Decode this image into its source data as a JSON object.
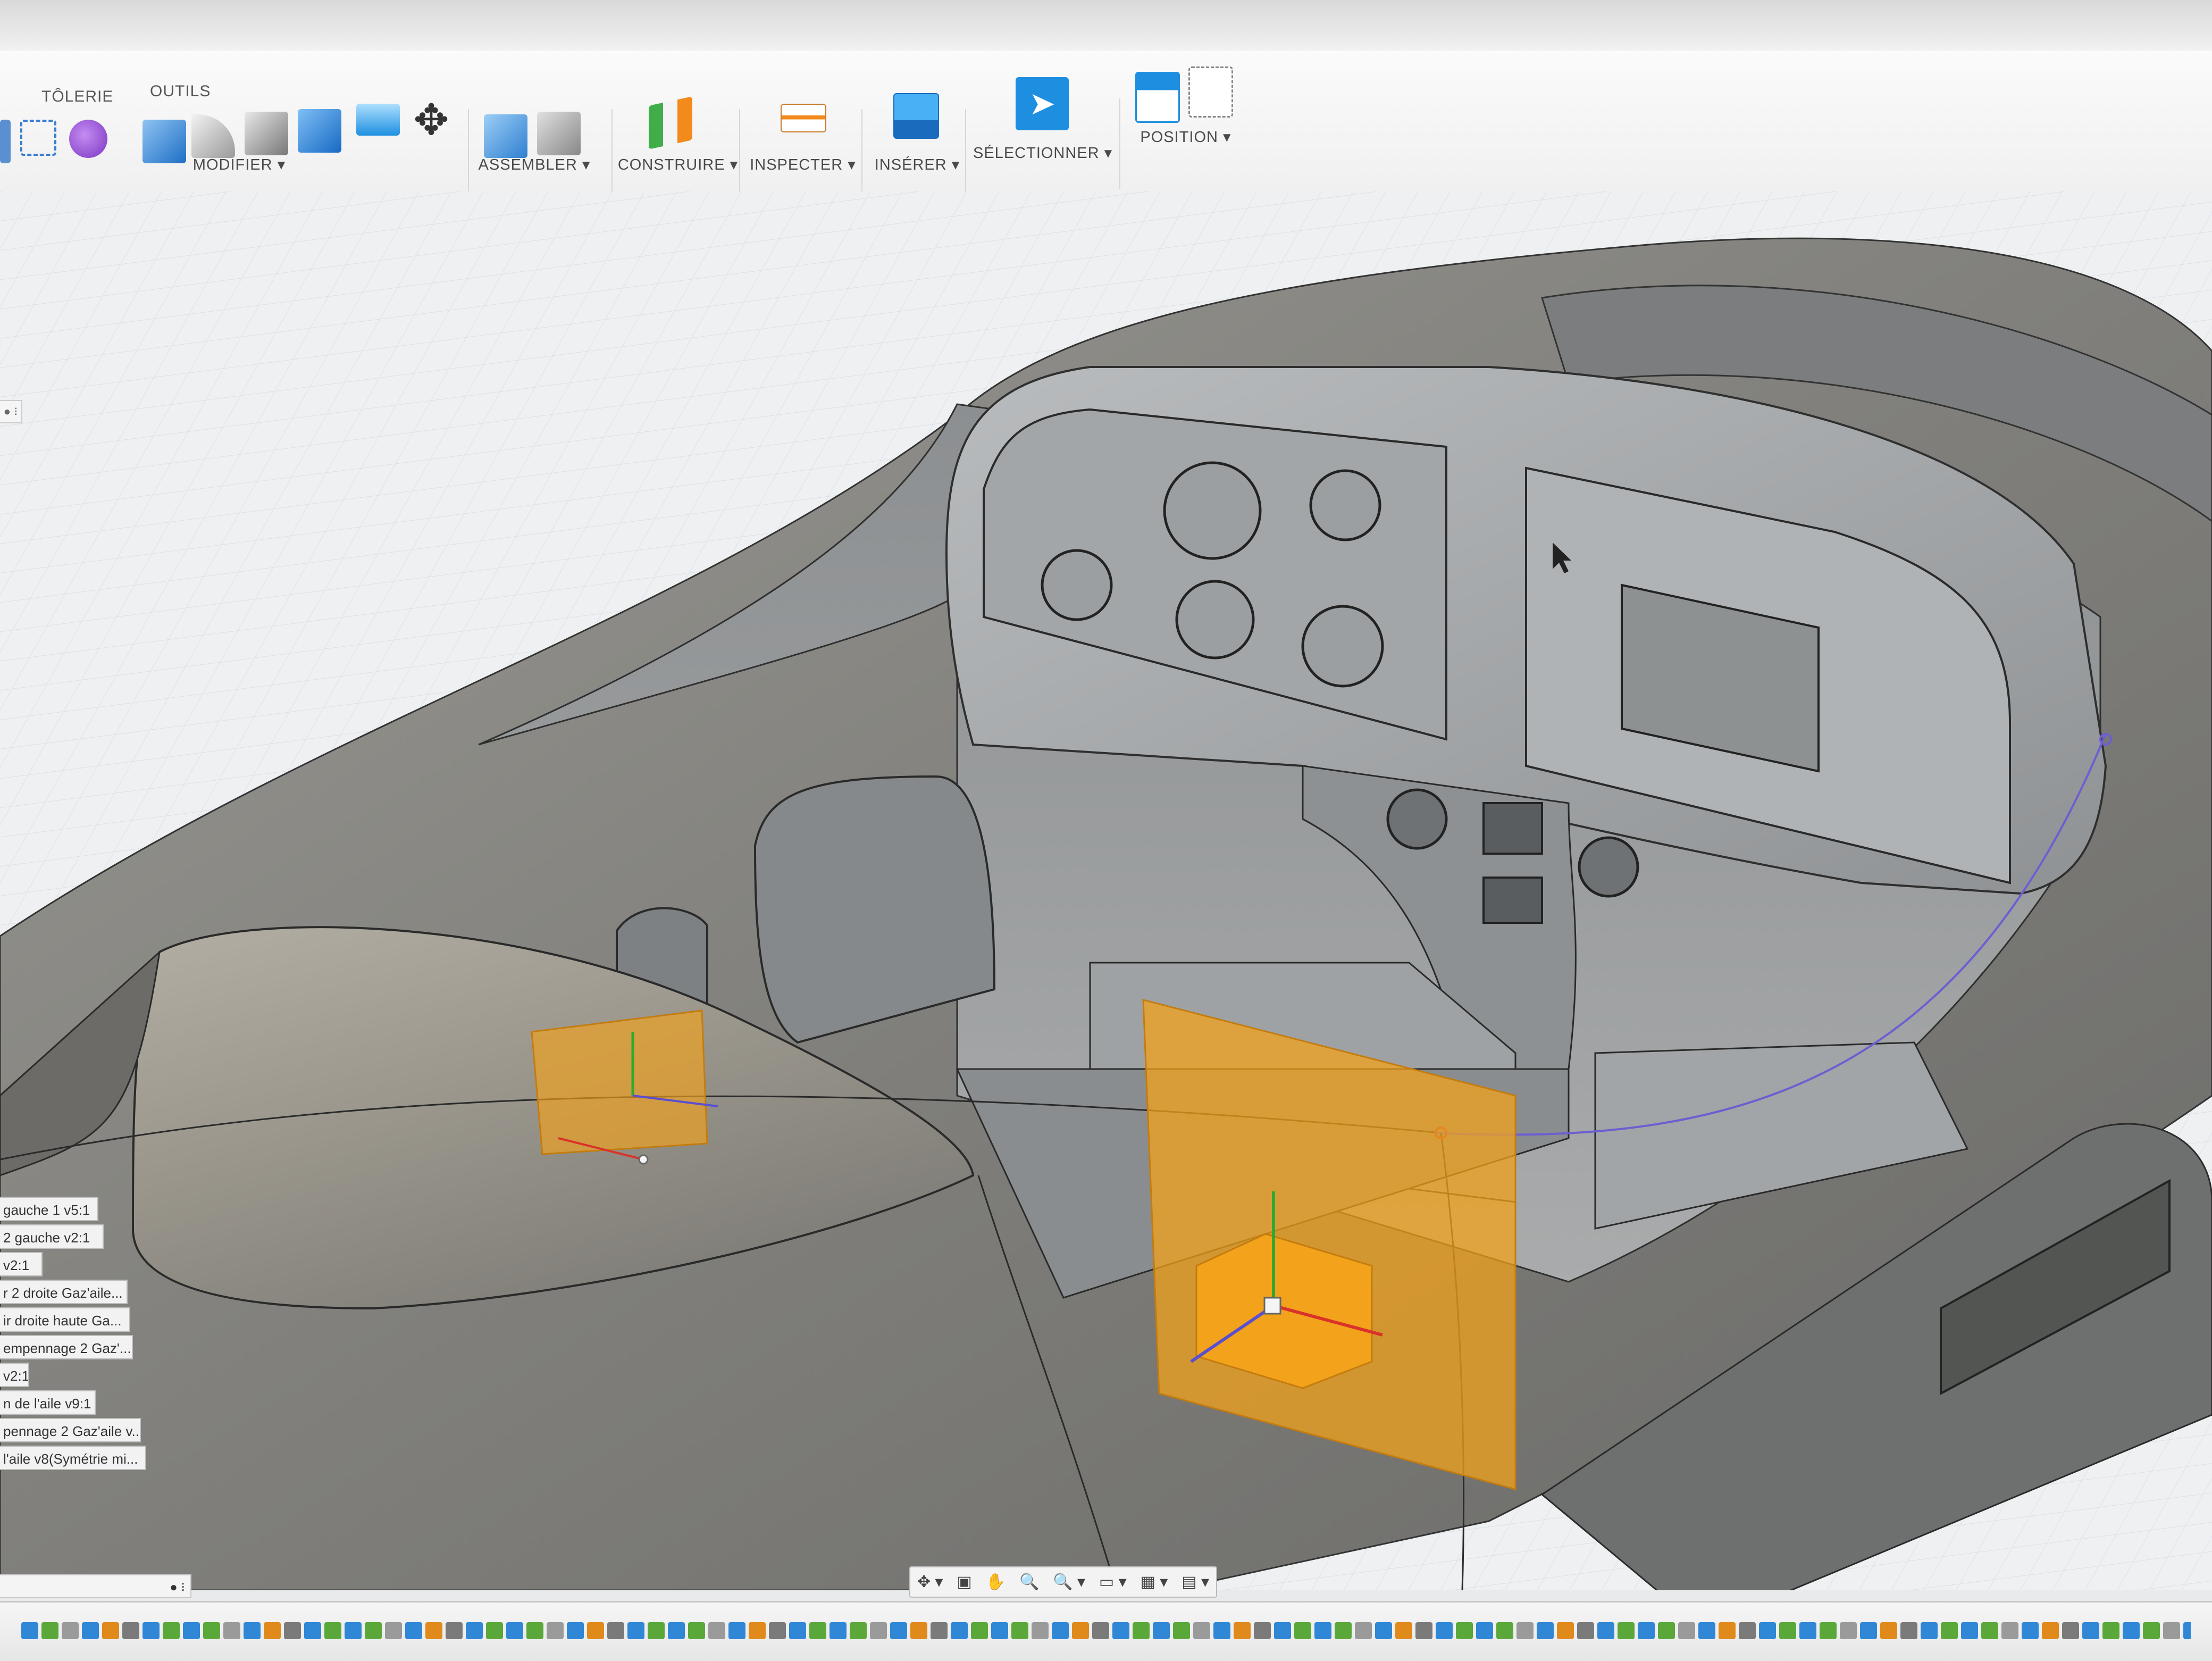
{
  "toolbar": {
    "tab_labels": {
      "sheet_metal": "TÔLERIE",
      "tools": "OUTILS"
    },
    "groups": {
      "modify": "MODIFIER ▾",
      "assemble": "ASSEMBLER ▾",
      "construct": "CONSTRUIRE ▾",
      "inspect": "INSPECTER ▾",
      "insert": "INSÉRER ▾",
      "select": "SÉLECTIONNER ▾",
      "position": "POSITION ▾"
    }
  },
  "browser": {
    "handle": "● ⁝",
    "items": [
      "gauche 1 v5:1",
      "2 gauche v2:1",
      " v2:1",
      "r 2 droite Gaz'aile...",
      "ir droite haute Ga...",
      "empennage 2 Gaz'...",
      "v2:1",
      "n de l'aile v9:1",
      "pennage 2 Gaz'aile v...",
      "l'aile v8(Symétrie mi..."
    ]
  },
  "bottom_panel": {
    "label": "●  ⁝"
  },
  "navbar": {
    "items": [
      "✥ ▾",
      "▣",
      "✋",
      "🔍",
      "🔍 ▾",
      "▭ ▾",
      "▦ ▾",
      "▤ ▾"
    ]
  },
  "colors": {
    "accent_blue": "#1e8fe0",
    "sketch_plane_orange": "#f2a21b",
    "model_gray": "#8c8c88",
    "grid": "#d5dde6"
  }
}
